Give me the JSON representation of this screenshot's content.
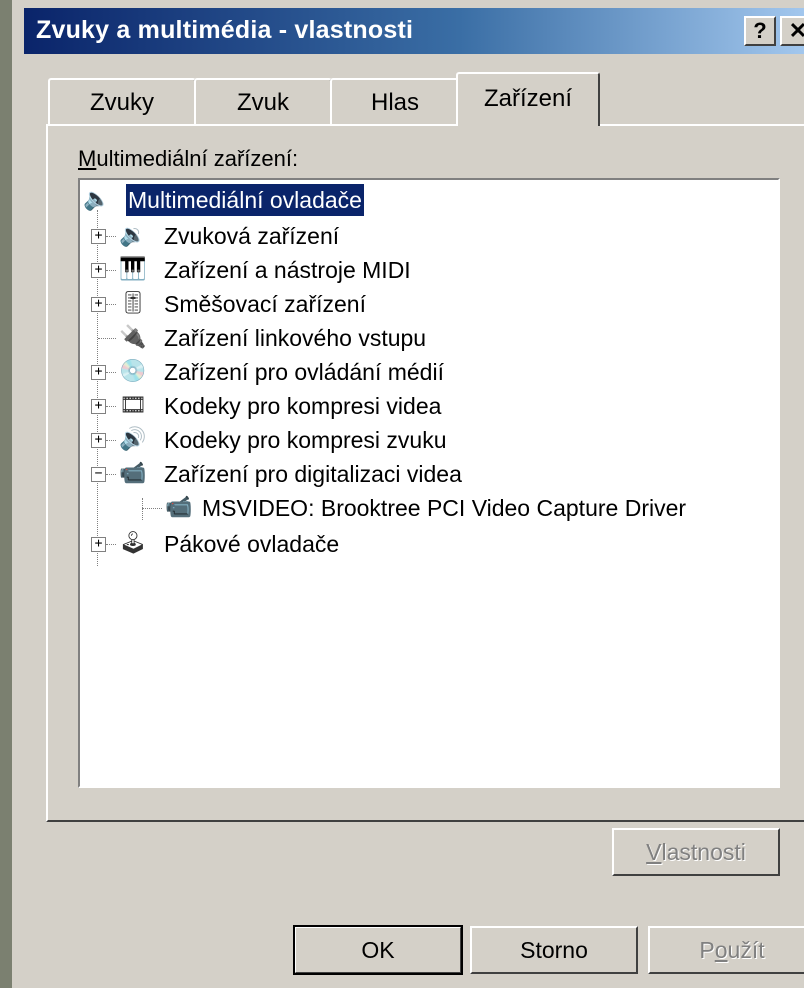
{
  "window": {
    "title": "Zvuky a multimédia - vlastnosti",
    "help_label": "?",
    "close_label": "✕"
  },
  "tabs": [
    {
      "label": "Zvuky",
      "active": false
    },
    {
      "label": "Zvuk",
      "active": false
    },
    {
      "label": "Hlas",
      "active": false
    },
    {
      "label": "Zařízení",
      "active": true
    }
  ],
  "group": {
    "label_underline": "M",
    "label_rest": "ultimediální zařízení:"
  },
  "tree": {
    "root": {
      "label": "Multimediální ovladače",
      "icon": "speaker-icon"
    },
    "items": [
      {
        "label": "Zvuková zařízení",
        "icon": "speaker-icon",
        "expander": "+"
      },
      {
        "label": "Zařízení a nástroje MIDI",
        "icon": "midi-icon",
        "expander": "+"
      },
      {
        "label": "Směšovací zařízení",
        "icon": "mixer-icon",
        "expander": "+"
      },
      {
        "label": "Zařízení linkového vstupu",
        "icon": "line-input-icon",
        "expander": ""
      },
      {
        "label": "Zařízení pro ovládání médií",
        "icon": "media-control-icon",
        "expander": "+"
      },
      {
        "label": "Kodeky pro kompresi videa",
        "icon": "video-codec-icon",
        "expander": "+"
      },
      {
        "label": "Kodeky pro kompresi zvuku",
        "icon": "audio-codec-icon",
        "expander": "+"
      },
      {
        "label": "Zařízení pro digitalizaci videa",
        "icon": "video-capture-icon",
        "expander": "−"
      }
    ],
    "child": {
      "label": "MSVIDEO: Brooktree PCI Video Capture Driver",
      "icon": "video-capture-icon"
    },
    "last": {
      "label": "Pákové ovladače",
      "icon": "joystick-icon",
      "expander": "+"
    }
  },
  "buttons": {
    "properties_underline": "V",
    "properties_rest": "lastnosti",
    "ok": "OK",
    "cancel": "Storno",
    "apply_pre": "P",
    "apply_underline": "o",
    "apply_rest": "užít"
  }
}
